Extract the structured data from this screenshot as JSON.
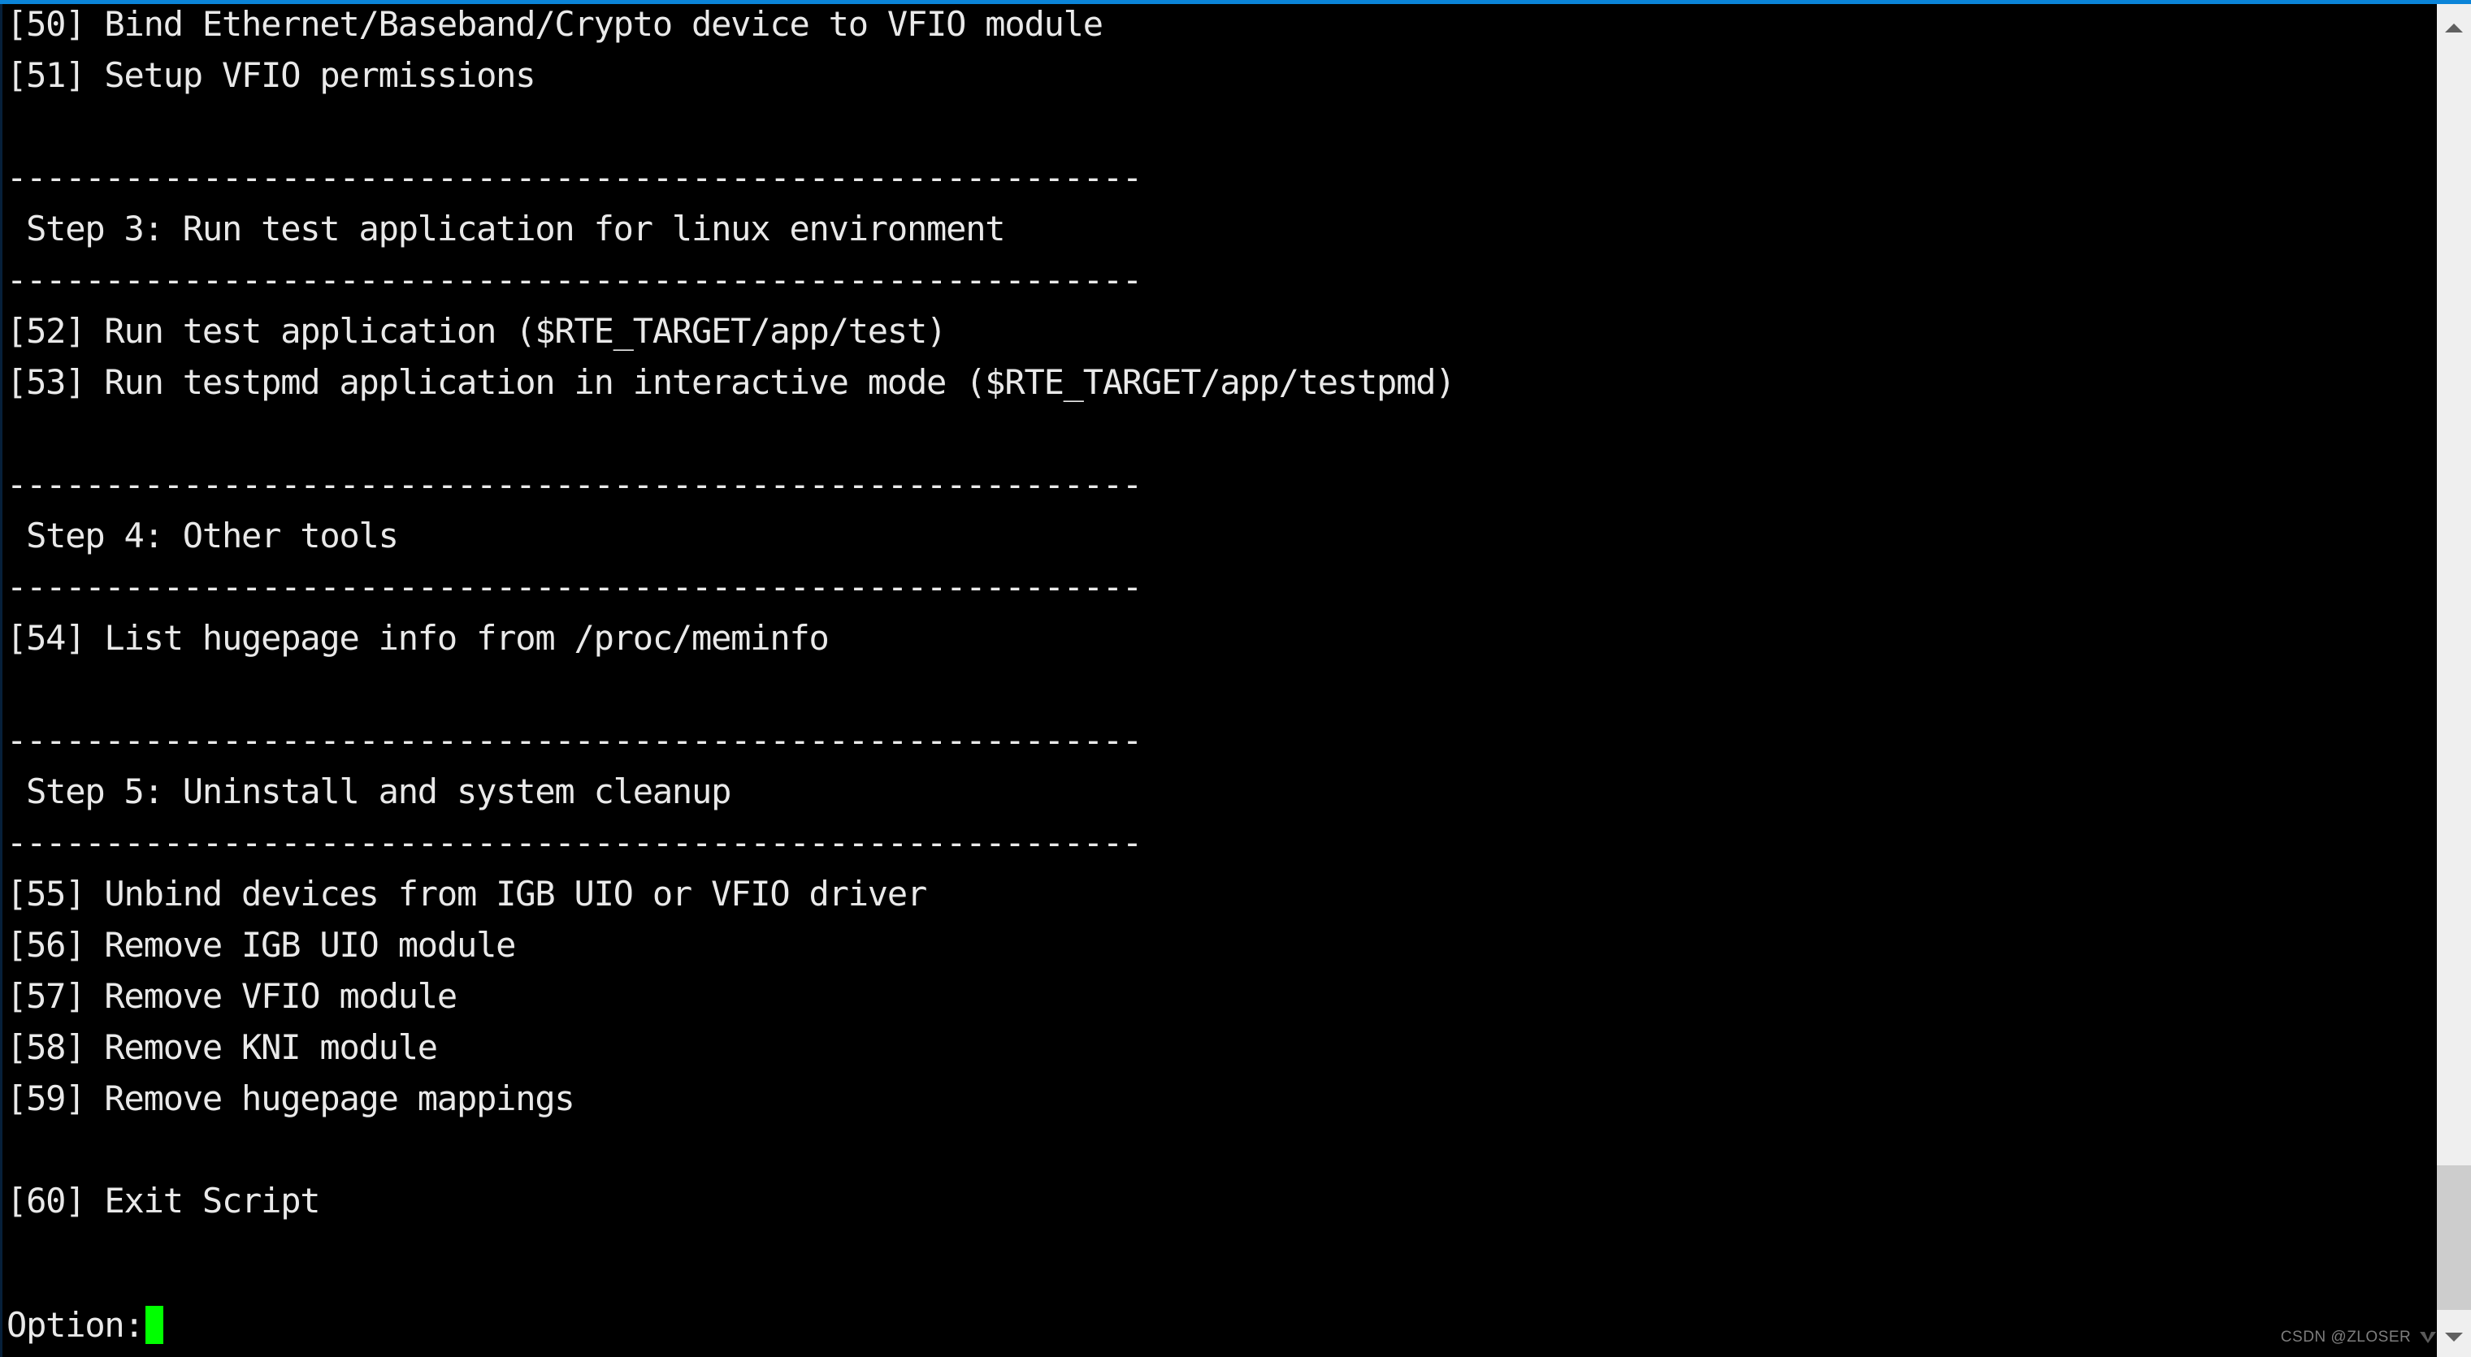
{
  "window": {
    "type": "terminal",
    "accent_color": "#0a84d8",
    "background_color": "#000000",
    "text_color": "#e9e9e9",
    "cursor_color": "#00ff00"
  },
  "terminal": {
    "lines": [
      "[50] Bind Ethernet/Baseband/Crypto device to VFIO module",
      "[51] Setup VFIO permissions",
      "",
      "----------------------------------------------------------",
      " Step 3: Run test application for linux environment",
      "----------------------------------------------------------",
      "[52] Run test application ($RTE_TARGET/app/test)",
      "[53] Run testpmd application in interactive mode ($RTE_TARGET/app/testpmd)",
      "",
      "----------------------------------------------------------",
      " Step 4: Other tools",
      "----------------------------------------------------------",
      "[54] List hugepage info from /proc/meminfo",
      "",
      "----------------------------------------------------------",
      " Step 5: Uninstall and system cleanup",
      "----------------------------------------------------------",
      "[55] Unbind devices from IGB UIO or VFIO driver",
      "[56] Remove IGB UIO module",
      "[57] Remove VFIO module",
      "[58] Remove KNI module",
      "[59] Remove hugepage mappings",
      "",
      "[60] Exit Script"
    ],
    "prompt": {
      "label": "Option:",
      "value": "",
      "cursor": "block"
    }
  },
  "scrollbar": {
    "up_arrow_icon": "chevron-up-icon",
    "down_arrow_icon": "chevron-down-icon",
    "thumb_position": "bottom"
  },
  "watermark": {
    "text": "CSDN @ZLOSER",
    "logo_icon": "csdn-logo-icon"
  }
}
